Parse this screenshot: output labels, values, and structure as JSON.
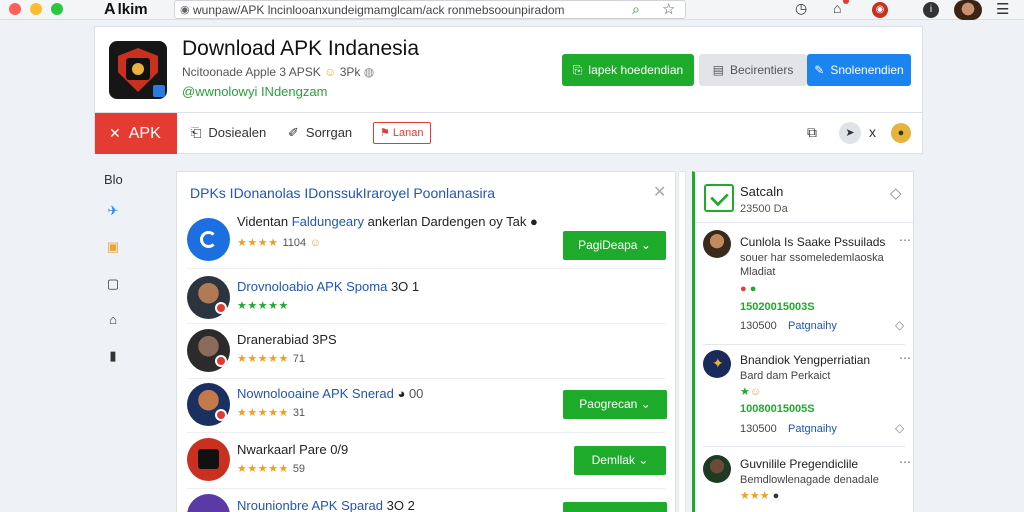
{
  "browser": {
    "brand": "lkim",
    "url": "wunpaw/APK lncinlooanxundeigmamglcam/ack ronmebsoounpiradom"
  },
  "app": {
    "title": "Download APK Indanesia",
    "subtitle": "Ncitoonade Apple 3 APSK",
    "subtitle_suffix": "3Pk",
    "handle": "@wwnolowyi INdengzam",
    "buttons": {
      "primary": "lapek hoedendian",
      "secondary": "Becirentiers",
      "tertiary": "Snolenendien"
    }
  },
  "nav": {
    "apk_label": "APK",
    "item1": "Dosiealen",
    "item2": "Sorrgan",
    "outlined": "Lanan",
    "close_glyph": "x"
  },
  "rail": [
    "Blo",
    "",
    "",
    "",
    "",
    ""
  ],
  "list": {
    "title": "DPKs IDonanolas IDonssukIraroyel Poonlanasira",
    "rows": [
      {
        "name_prefix": "Videntan",
        "name_link": "Faldungeary",
        "name_rest": "ankerlan Dardengen oy Tak",
        "stars": "★★★★",
        "count": "1104",
        "button": "PagiDeapa"
      },
      {
        "name_link": "Drovnoloabio APK Spoma",
        "name_rest": "3O  1",
        "stars": "★★★★★",
        "count": "",
        "button": ""
      },
      {
        "name_rest": "Dranerabiad 3PS",
        "stars": "★★★★★",
        "count": "71",
        "button": ""
      },
      {
        "name_link": "Nownolooaine APK Snerad",
        "name_rest": "00",
        "stars": "★★★★★",
        "count": "31",
        "button": "Paogrecan"
      },
      {
        "name_rest": "Nwarkaarl Pare 0/9",
        "stars": "★★★★★",
        "count": "59",
        "button": "Demllak"
      },
      {
        "name_link": "Nrounionbre APK Sparad",
        "name_rest": "3O 2",
        "stars": "",
        "count": "",
        "button": ""
      }
    ]
  },
  "side": {
    "title": "Satcaln",
    "subtitle": "23500 Da",
    "items": [
      {
        "name": "Cunlola Is Saake Pssuilads",
        "desc": "souer har ssomeledemlaoska Mladiat",
        "green": "15020015003S",
        "num": "130500",
        "link": "Patgnaihy"
      },
      {
        "name": "Bnandiok Yengperriatian",
        "desc": "Bard dam Perkaict",
        "green": "10080015005S",
        "num": "130500",
        "link": "Patgnaihy"
      },
      {
        "name": "Guvnilile Pregendiclile",
        "desc": "Bemdlowlenagade denadale",
        "green": "",
        "num": "",
        "link": ""
      }
    ]
  },
  "colors": {
    "green": "#1eab2b",
    "blue": "#1c84f0",
    "red": "#e43b33",
    "link": "#2155b8"
  }
}
